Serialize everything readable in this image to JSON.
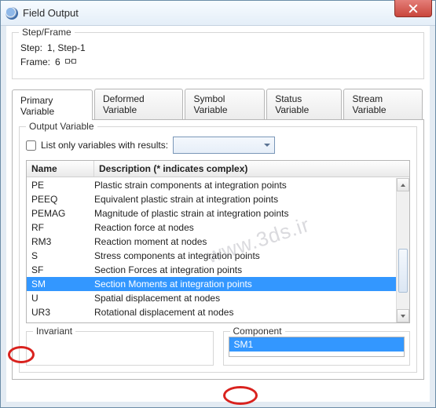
{
  "window": {
    "title": "Field Output"
  },
  "step_frame": {
    "legend": "Step/Frame",
    "step_label": "Step:",
    "step_value": "1, Step-1",
    "frame_label": "Frame:",
    "frame_value": "6"
  },
  "tabs": {
    "primary": "Primary Variable",
    "deformed": "Deformed Variable",
    "symbol": "Symbol Variable",
    "status": "Status Variable",
    "stream": "Stream Variable"
  },
  "output": {
    "legend": "Output Variable",
    "list_only_label": "List only variables with results:",
    "head_name": "Name",
    "head_desc": "Description (* indicates complex)",
    "rows": [
      {
        "name": "PE",
        "desc": "Plastic strain components at integration points"
      },
      {
        "name": "PEEQ",
        "desc": "Equivalent plastic strain at integration points"
      },
      {
        "name": "PEMAG",
        "desc": "Magnitude of plastic strain at integration points"
      },
      {
        "name": "RF",
        "desc": "Reaction force at nodes"
      },
      {
        "name": "RM3",
        "desc": "Reaction moment at nodes"
      },
      {
        "name": "S",
        "desc": "Stress components at integration points"
      },
      {
        "name": "SF",
        "desc": "Section Forces at integration points"
      },
      {
        "name": "SM",
        "desc": "Section Moments at integration points"
      },
      {
        "name": "U",
        "desc": "Spatial displacement at nodes"
      },
      {
        "name": "UR3",
        "desc": "Rotational displacement at nodes"
      }
    ],
    "selected_index": 7
  },
  "invariant": {
    "legend": "Invariant"
  },
  "component": {
    "legend": "Component",
    "items": [
      "SM1"
    ],
    "selected": "SM1"
  },
  "watermark": "www.3ds.ir"
}
